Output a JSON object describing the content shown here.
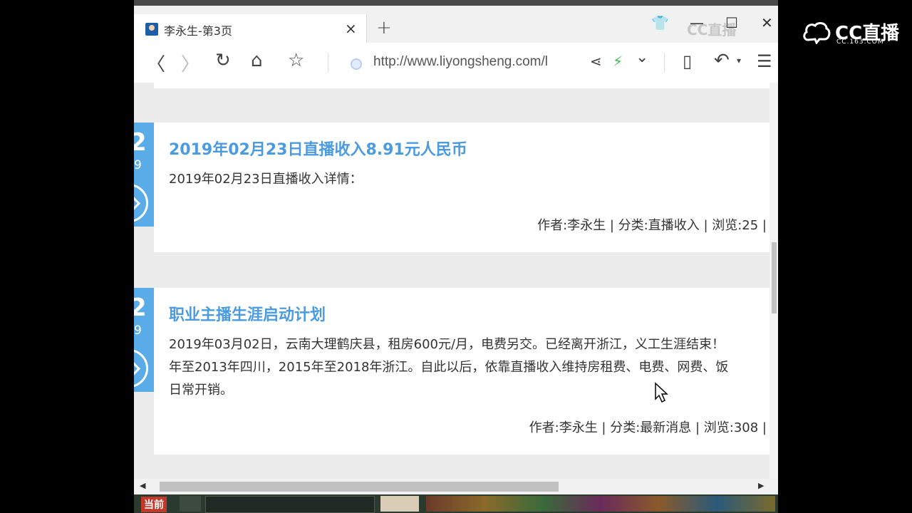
{
  "tab": {
    "title": "李永生-第3页",
    "close": "×",
    "new_tab": "+"
  },
  "window": {
    "tshirt": "👕",
    "minimize": "—",
    "maximize": "☐",
    "close": "✕",
    "watermark": "CC直播"
  },
  "nav": {
    "back": "〈",
    "forward": "〉",
    "refresh": "↻",
    "home": "⌂",
    "star": "☆",
    "url": "http://www.liyongsheng.com/l",
    "share": "⋖",
    "bolt": "⚡",
    "dropdown": "⌄",
    "tablet": "▯",
    "undo": "↶",
    "undo_drop": "▾",
    "menu": "☰"
  },
  "posts": [
    {
      "date_day": "2",
      "date_year": "9",
      "title": "2019年02月23日直播收入8.91元人民币",
      "body_lines": [
        "2019年02月23日直播收入详情："
      ],
      "meta": "作者:李永生 | 分类:直播收入 | 浏览:25 |"
    },
    {
      "date_day": "2",
      "date_year": "9",
      "title": "职业主播生涯启动计划",
      "body_lines": [
        "2019年03月02日，云南大理鹤庆县，租房600元/月，电费另交。已经离开浙江，义工生涯结束！",
        "年至2013年四川，2015年至2018年浙江。自此以后，依靠直播收入维持房租费、电费、网费、饭",
        "日常开销。"
      ],
      "meta": "作者:李永生 | 分类:最新消息 | 浏览:308 |"
    }
  ],
  "scroll": {
    "left": "◀",
    "right": "▶"
  },
  "taskbar": {
    "now": "当前"
  },
  "brand": {
    "name": "CC直播",
    "sub": "CC.163.COM"
  },
  "colors": {
    "accent": "#4b9be0",
    "date_block": "#5aace8"
  }
}
